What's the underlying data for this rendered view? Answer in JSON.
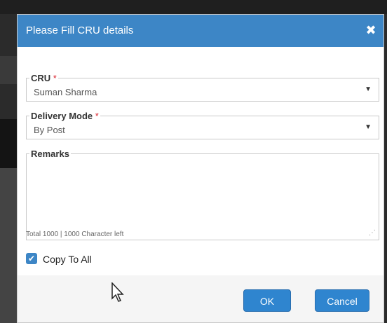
{
  "dialog": {
    "title": "Please Fill CRU details",
    "close_label": "✖"
  },
  "form": {
    "cru": {
      "label": "CRU",
      "required_mark": "*",
      "value": "Suman Sharma"
    },
    "delivery_mode": {
      "label": "Delivery Mode",
      "required_mark": "*",
      "value": "By Post"
    },
    "remarks": {
      "label": "Remarks",
      "value": ""
    },
    "counter_text": "Total 1000 | 1000 Character left",
    "copy_to_all": {
      "label": "Copy To All",
      "checked": true
    }
  },
  "buttons": {
    "ok": "OK",
    "cancel": "Cancel"
  },
  "colors": {
    "header": "#3d86c6",
    "button": "#2f85cf",
    "required": "#d9232d"
  }
}
